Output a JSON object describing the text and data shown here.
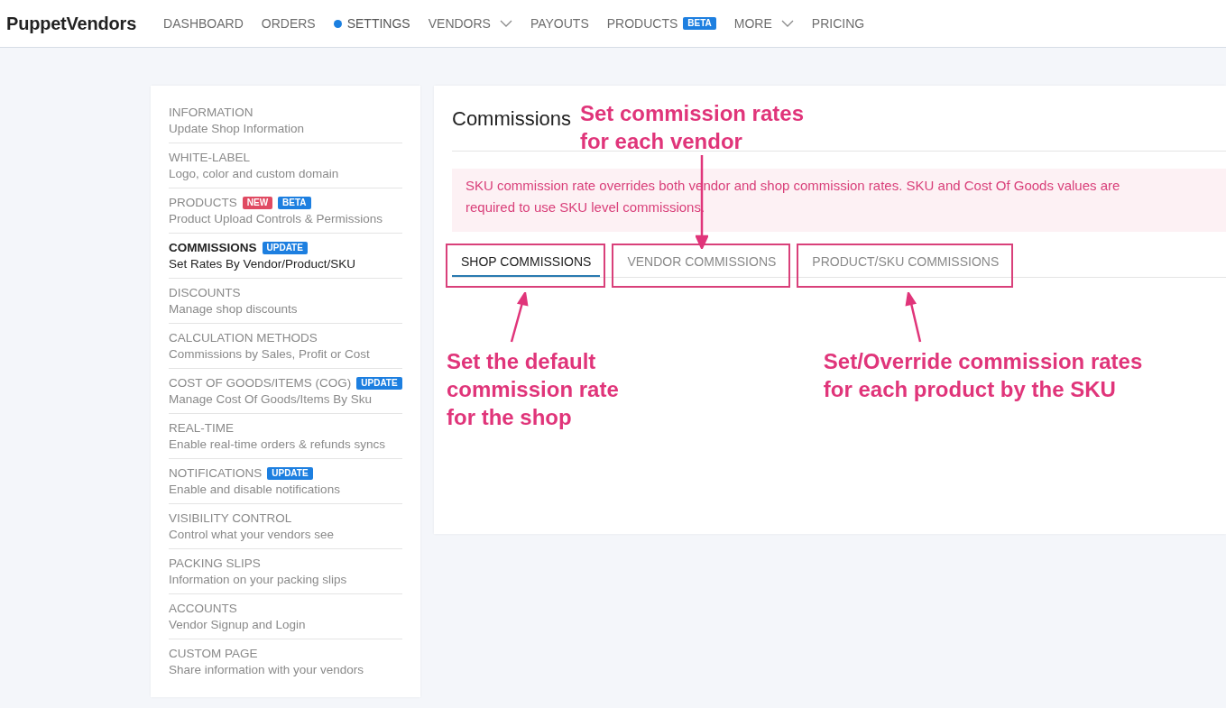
{
  "navbar": {
    "logo": "PuppetVendors",
    "items": [
      {
        "label": "DASHBOARD",
        "selected": false,
        "dropdown": false
      },
      {
        "label": "ORDERS",
        "selected": false,
        "dropdown": false
      },
      {
        "label": "SETTINGS",
        "selected": true,
        "dropdown": false
      },
      {
        "label": "VENDORS",
        "selected": false,
        "dropdown": true
      },
      {
        "label": "PAYOUTS",
        "selected": false,
        "dropdown": false
      },
      {
        "label": "PRODUCTS",
        "selected": false,
        "dropdown": false,
        "badges": [
          {
            "text": "BETA",
            "kind": "beta"
          }
        ]
      },
      {
        "label": "MORE",
        "selected": false,
        "dropdown": true
      },
      {
        "label": "PRICING",
        "selected": false,
        "dropdown": false
      }
    ]
  },
  "sidebar": {
    "items": [
      {
        "title": "INFORMATION",
        "subtitle": "Update Shop Information",
        "selected": false
      },
      {
        "title": "WHITE-LABEL",
        "subtitle": "Logo, color and custom domain",
        "selected": false
      },
      {
        "title": "PRODUCTS",
        "subtitle": "Product Upload Controls & Permissions",
        "selected": false,
        "badges": [
          {
            "text": "NEW",
            "kind": "new"
          },
          {
            "text": "BETA",
            "kind": "beta"
          }
        ]
      },
      {
        "title": "COMMISSIONS",
        "subtitle": "Set Rates By Vendor/Product/SKU",
        "selected": true,
        "badges": [
          {
            "text": "UPDATE",
            "kind": "update"
          }
        ]
      },
      {
        "title": "DISCOUNTS",
        "subtitle": "Manage shop discounts",
        "selected": false
      },
      {
        "title": "CALCULATION METHODS",
        "subtitle": "Commissions by Sales, Profit or Cost",
        "selected": false
      },
      {
        "title": "COST OF GOODS/ITEMS (COG)",
        "subtitle": "Manage Cost Of Goods/Items By Sku",
        "selected": false,
        "badges": [
          {
            "text": "UPDATE",
            "kind": "update"
          }
        ]
      },
      {
        "title": "REAL-TIME",
        "subtitle": "Enable real-time orders & refunds syncs",
        "selected": false
      },
      {
        "title": "NOTIFICATIONS",
        "subtitle": "Enable and disable notifications",
        "selected": false,
        "badges": [
          {
            "text": "UPDATE",
            "kind": "update"
          }
        ]
      },
      {
        "title": "VISIBILITY CONTROL",
        "subtitle": "Control what your vendors see",
        "selected": false
      },
      {
        "title": "PACKING SLIPS",
        "subtitle": "Information on your packing slips",
        "selected": false
      },
      {
        "title": "ACCOUNTS",
        "subtitle": "Vendor Signup and Login",
        "selected": false
      },
      {
        "title": "CUSTOM PAGE",
        "subtitle": "Share information with your vendors",
        "selected": false
      }
    ]
  },
  "main": {
    "title": "Commissions",
    "alert": "SKU commission rate overrides both vendor and shop commission rates. SKU and Cost Of Goods values are required to use SKU level commissions.",
    "tabs": [
      {
        "label": "SHOP COMMISSIONS",
        "selected": true,
        "highlighted": true
      },
      {
        "label": "VENDOR COMMISSIONS",
        "selected": false,
        "highlighted": true
      },
      {
        "label": "PRODUCT/SKU COMMISSIONS",
        "selected": false,
        "highlighted": true
      }
    ]
  },
  "annotations": [
    {
      "text": "Set the default\ncommission rate\nfor the shop",
      "kind": "below"
    },
    {
      "text": "Set commission rates\nfor each vendor",
      "kind": "above"
    },
    {
      "text": "Set/Override commission rates\nfor each product by the SKU",
      "kind": "below"
    }
  ]
}
